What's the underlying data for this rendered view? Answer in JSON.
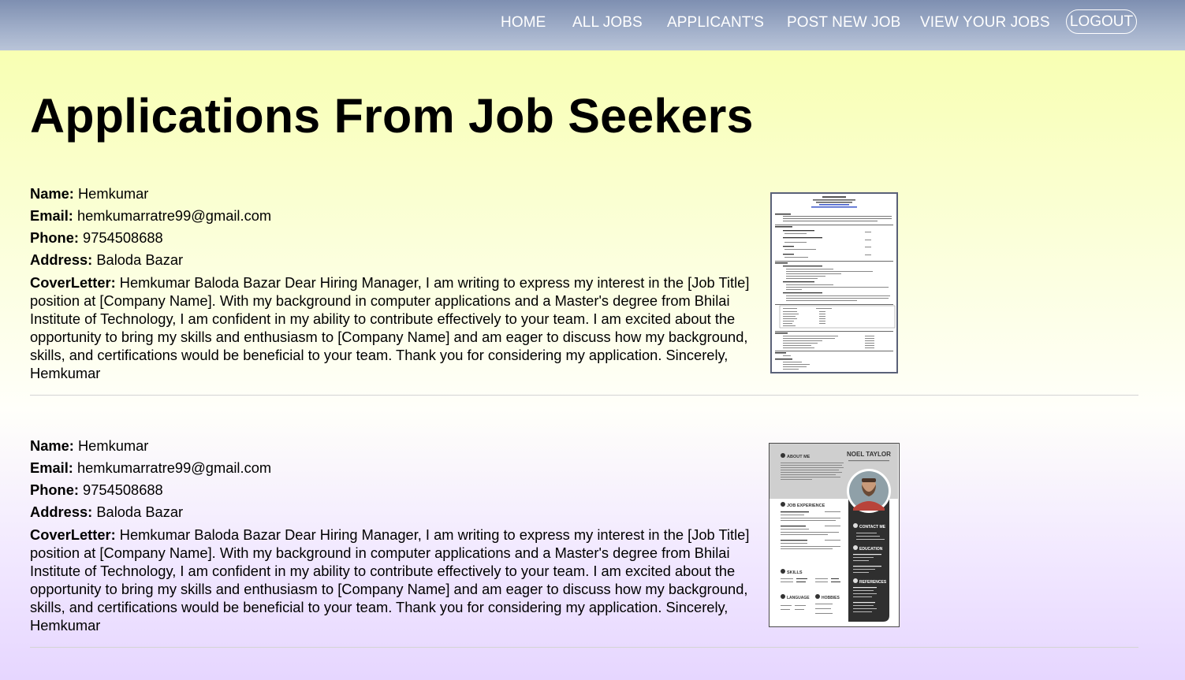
{
  "nav": {
    "items": [
      "HOME",
      "ALL JOBS",
      "APPLICANT'S",
      "POST NEW JOB",
      "VIEW YOUR JOBS"
    ],
    "logout": "LOGOUT"
  },
  "page": {
    "title": "Applications From Job Seekers"
  },
  "labels": {
    "name": "Name:",
    "email": "Email:",
    "phone": "Phone:",
    "address": "Address:",
    "cover": "CoverLetter:"
  },
  "applications": [
    {
      "name": "Hemkumar",
      "email": "hemkumarratre99@gmail.com",
      "phone": "9754508688",
      "address": "Baloda Bazar",
      "cover_letter": "Hemkumar Baloda Bazar Dear Hiring Manager, I am writing to express my interest in the [Job Title] position at [Company Name]. With my background in computer applications and a Master's degree from Bhilai Institute of Technology, I am confident in my ability to contribute effectively to your team. I am excited about the opportunity to bring my skills and enthusiasm to [Company Name] and am eager to discuss how my background, skills, and certifications would be beneficial to your team. Thank you for considering my application. Sincerely, Hemkumar",
      "resume_icon": "document-resume-thumbnail"
    },
    {
      "name": "Hemkumar",
      "email": "hemkumarratre99@gmail.com",
      "phone": "9754508688",
      "address": "Baloda Bazar",
      "cover_letter": "Hemkumar Baloda Bazar Dear Hiring Manager, I am writing to express my interest in the [Job Title] position at [Company Name]. With my background in computer applications and a Master's degree from Bhilai Institute of Technology, I am confident in my ability to contribute effectively to your team. I am excited about the opportunity to bring my skills and enthusiasm to [Company Name] and am eager to discuss how my background, skills, and certifications would be beneficial to your team. Thank you for considering my application. Sincerely, Hemkumar",
      "resume_icon": "template-resume-thumbnail",
      "resume_text": {
        "name": "NOEL TAYLOR",
        "sections": [
          "ABOUT ME",
          "JOB EXPERIENCE",
          "SKILLS",
          "LANGUAGE",
          "HOBBIES",
          "CONTACT ME",
          "EDUCATION",
          "REFERENCES"
        ]
      }
    }
  ],
  "colors": {
    "nav_top": "#7e8fb1",
    "nav_bottom": "#b9c4d8",
    "bg_top": "#f7ffa8",
    "bg_bottom": "#e6d6ff"
  }
}
